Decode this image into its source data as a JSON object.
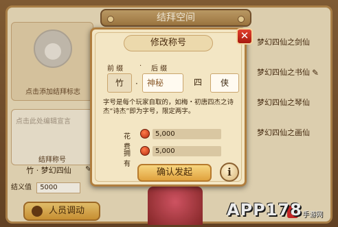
{
  "window": {
    "title": "结拜空间"
  },
  "left": {
    "emblem_label": "点击添加结拜标志",
    "manifesto_placeholder": "点击此处编辑宣言",
    "title_label": "结拜称号",
    "title_value": "竹 · 梦幻四仙",
    "score_label": "结义值",
    "score_value": "5000",
    "transfer_button": "人员调动"
  },
  "members": [
    {
      "name": "梦幻四仙之剑仙"
    },
    {
      "name": "梦幻四仙之书仙"
    },
    {
      "name": "梦幻四仙之琴仙"
    },
    {
      "name": "梦幻四仙之画仙"
    }
  ],
  "modal": {
    "title": "修改称号",
    "prefix_label": "前 缀",
    "suffix_label": "后 缀",
    "prefix_value": "竹",
    "dot": "·",
    "middle_value": "神秘",
    "number_value": "四",
    "suffix_value": "侠",
    "description": "字号是每个玩家自取的，如梅・初唐四杰之诗杰“诗杰”即为字号，限定两字。",
    "fee_label": "花费",
    "fee_value": "5,000",
    "own_label": "拥有",
    "own_value": "5,000",
    "confirm_button": "确认发起",
    "info_button": "i",
    "close_button": "✕"
  },
  "watermark": {
    "text": "APP178",
    "sub": "手游网"
  }
}
